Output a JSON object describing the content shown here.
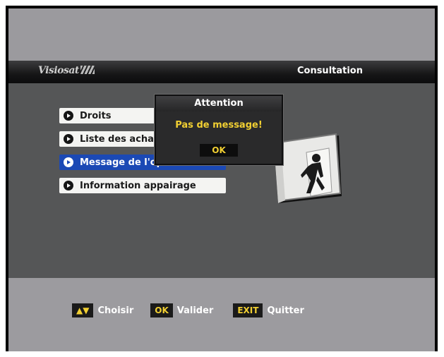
{
  "header": {
    "logo_text": "Visiosat",
    "title": "Consultation"
  },
  "menu": {
    "items": [
      {
        "label": "Droits"
      },
      {
        "label": "Liste des achats"
      },
      {
        "label": "Message de l'opérateur"
      },
      {
        "label": "Information appairage"
      }
    ],
    "selected_index": 2
  },
  "dialog": {
    "title": "Attention",
    "message": "Pas de message!",
    "ok_label": "OK"
  },
  "footer": {
    "keys": [
      {
        "key": "▲▼",
        "label": "Choisir"
      },
      {
        "key": "OK",
        "label": "Valider"
      },
      {
        "key": "EXIT",
        "label": "Quitter"
      }
    ]
  },
  "colors": {
    "selection": "#1b49b5",
    "accent_yellow": "#f1cf32"
  }
}
